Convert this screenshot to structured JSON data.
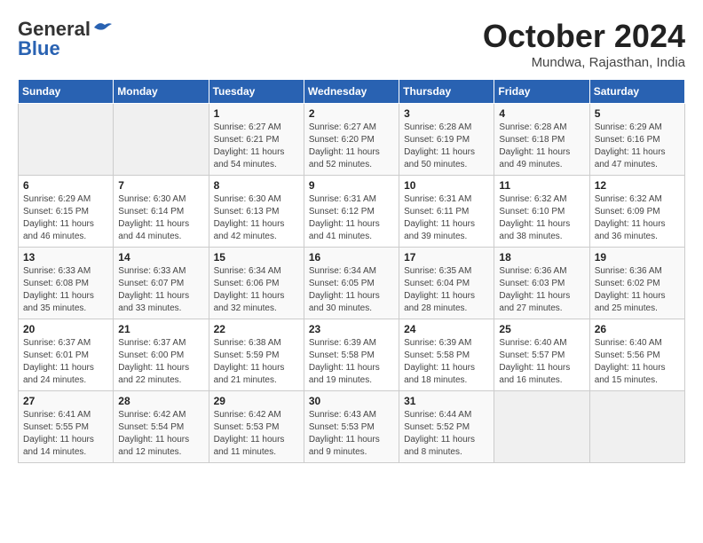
{
  "logo": {
    "line1": "General",
    "line2": "Blue"
  },
  "title": "October 2024",
  "subtitle": "Mundwa, Rajasthan, India",
  "weekdays": [
    "Sunday",
    "Monday",
    "Tuesday",
    "Wednesday",
    "Thursday",
    "Friday",
    "Saturday"
  ],
  "weeks": [
    [
      {
        "day": "",
        "detail": ""
      },
      {
        "day": "",
        "detail": ""
      },
      {
        "day": "1",
        "detail": "Sunrise: 6:27 AM\nSunset: 6:21 PM\nDaylight: 11 hours and 54 minutes."
      },
      {
        "day": "2",
        "detail": "Sunrise: 6:27 AM\nSunset: 6:20 PM\nDaylight: 11 hours and 52 minutes."
      },
      {
        "day": "3",
        "detail": "Sunrise: 6:28 AM\nSunset: 6:19 PM\nDaylight: 11 hours and 50 minutes."
      },
      {
        "day": "4",
        "detail": "Sunrise: 6:28 AM\nSunset: 6:18 PM\nDaylight: 11 hours and 49 minutes."
      },
      {
        "day": "5",
        "detail": "Sunrise: 6:29 AM\nSunset: 6:16 PM\nDaylight: 11 hours and 47 minutes."
      }
    ],
    [
      {
        "day": "6",
        "detail": "Sunrise: 6:29 AM\nSunset: 6:15 PM\nDaylight: 11 hours and 46 minutes."
      },
      {
        "day": "7",
        "detail": "Sunrise: 6:30 AM\nSunset: 6:14 PM\nDaylight: 11 hours and 44 minutes."
      },
      {
        "day": "8",
        "detail": "Sunrise: 6:30 AM\nSunset: 6:13 PM\nDaylight: 11 hours and 42 minutes."
      },
      {
        "day": "9",
        "detail": "Sunrise: 6:31 AM\nSunset: 6:12 PM\nDaylight: 11 hours and 41 minutes."
      },
      {
        "day": "10",
        "detail": "Sunrise: 6:31 AM\nSunset: 6:11 PM\nDaylight: 11 hours and 39 minutes."
      },
      {
        "day": "11",
        "detail": "Sunrise: 6:32 AM\nSunset: 6:10 PM\nDaylight: 11 hours and 38 minutes."
      },
      {
        "day": "12",
        "detail": "Sunrise: 6:32 AM\nSunset: 6:09 PM\nDaylight: 11 hours and 36 minutes."
      }
    ],
    [
      {
        "day": "13",
        "detail": "Sunrise: 6:33 AM\nSunset: 6:08 PM\nDaylight: 11 hours and 35 minutes."
      },
      {
        "day": "14",
        "detail": "Sunrise: 6:33 AM\nSunset: 6:07 PM\nDaylight: 11 hours and 33 minutes."
      },
      {
        "day": "15",
        "detail": "Sunrise: 6:34 AM\nSunset: 6:06 PM\nDaylight: 11 hours and 32 minutes."
      },
      {
        "day": "16",
        "detail": "Sunrise: 6:34 AM\nSunset: 6:05 PM\nDaylight: 11 hours and 30 minutes."
      },
      {
        "day": "17",
        "detail": "Sunrise: 6:35 AM\nSunset: 6:04 PM\nDaylight: 11 hours and 28 minutes."
      },
      {
        "day": "18",
        "detail": "Sunrise: 6:36 AM\nSunset: 6:03 PM\nDaylight: 11 hours and 27 minutes."
      },
      {
        "day": "19",
        "detail": "Sunrise: 6:36 AM\nSunset: 6:02 PM\nDaylight: 11 hours and 25 minutes."
      }
    ],
    [
      {
        "day": "20",
        "detail": "Sunrise: 6:37 AM\nSunset: 6:01 PM\nDaylight: 11 hours and 24 minutes."
      },
      {
        "day": "21",
        "detail": "Sunrise: 6:37 AM\nSunset: 6:00 PM\nDaylight: 11 hours and 22 minutes."
      },
      {
        "day": "22",
        "detail": "Sunrise: 6:38 AM\nSunset: 5:59 PM\nDaylight: 11 hours and 21 minutes."
      },
      {
        "day": "23",
        "detail": "Sunrise: 6:39 AM\nSunset: 5:58 PM\nDaylight: 11 hours and 19 minutes."
      },
      {
        "day": "24",
        "detail": "Sunrise: 6:39 AM\nSunset: 5:58 PM\nDaylight: 11 hours and 18 minutes."
      },
      {
        "day": "25",
        "detail": "Sunrise: 6:40 AM\nSunset: 5:57 PM\nDaylight: 11 hours and 16 minutes."
      },
      {
        "day": "26",
        "detail": "Sunrise: 6:40 AM\nSunset: 5:56 PM\nDaylight: 11 hours and 15 minutes."
      }
    ],
    [
      {
        "day": "27",
        "detail": "Sunrise: 6:41 AM\nSunset: 5:55 PM\nDaylight: 11 hours and 14 minutes."
      },
      {
        "day": "28",
        "detail": "Sunrise: 6:42 AM\nSunset: 5:54 PM\nDaylight: 11 hours and 12 minutes."
      },
      {
        "day": "29",
        "detail": "Sunrise: 6:42 AM\nSunset: 5:53 PM\nDaylight: 11 hours and 11 minutes."
      },
      {
        "day": "30",
        "detail": "Sunrise: 6:43 AM\nSunset: 5:53 PM\nDaylight: 11 hours and 9 minutes."
      },
      {
        "day": "31",
        "detail": "Sunrise: 6:44 AM\nSunset: 5:52 PM\nDaylight: 11 hours and 8 minutes."
      },
      {
        "day": "",
        "detail": ""
      },
      {
        "day": "",
        "detail": ""
      }
    ]
  ]
}
